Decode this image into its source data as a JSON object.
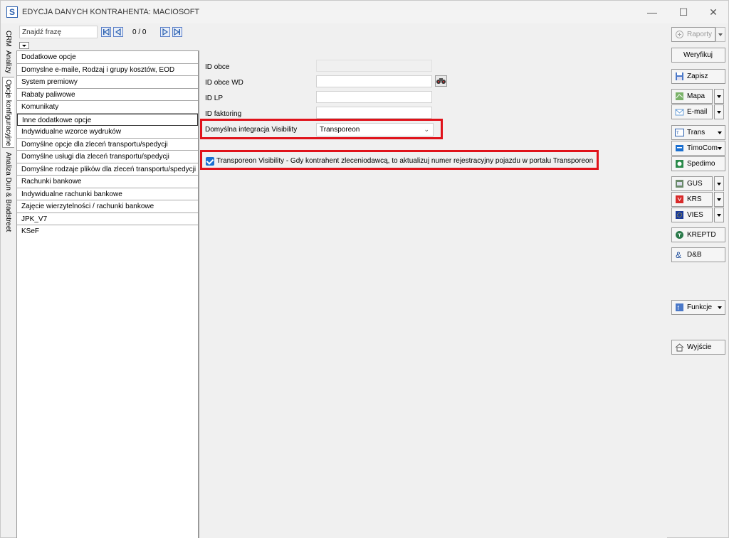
{
  "window": {
    "title": "EDYCJA DANYCH KONTRAHENTA: MACIOSOFT",
    "icon_letter": "S",
    "minimize": "—",
    "maximize": "☐",
    "close": "✕"
  },
  "vtabs": [
    "CRM",
    "Analizy",
    "Opcje konfiguracyjne",
    "Analiza Dun & Bradstreet"
  ],
  "search": {
    "placeholder": "Znajdź frazę",
    "value": "",
    "counter": "0 / 0"
  },
  "options": [
    "Dodatkowe opcje",
    "Domyslne e-maile, Rodzaj i grupy kosztów, EOD",
    "System premiowy",
    "Rabaty paliwowe",
    "Komunikaty",
    "Inne dodatkowe opcje",
    "Indywidualne wzorce wydruków",
    "Domyślne opcje dla zleceń transportu/spedycji",
    "Domyślne usługi dla zleceń transportu/spedycji",
    "Domyślne rodzaje plików dla zleceń transportu/spedycji",
    "Rachunki bankowe",
    "Indywidualne rachunki bankowe",
    "Zajęcie wierzytelności / rachunki bankowe",
    "JPK_V7",
    "KSeF"
  ],
  "selected_option_index": 5,
  "form": {
    "id_obce_label": "ID obce",
    "id_obce_wd_label": "ID obce WD",
    "id_lp_label": "ID LP",
    "id_faktoring_label": "ID faktoring",
    "visibility_label": "Domyślna integracja Visibility",
    "visibility_value": "Transporeon",
    "checkbox_label": "Transporeon Visibility - Gdy kontrahent zleceniodawcą, to aktualizuj numer rejestracyjny pojazdu w portalu Transporeon",
    "checkbox_checked": true
  },
  "right_buttons": {
    "raporty": "Raporty",
    "weryfikuj": "Weryfikuj",
    "zapisz": "Zapisz",
    "mapa": "Mapa",
    "email": "E-mail",
    "trans": "Trans",
    "timocom": "TimoCom",
    "spedimo": "Spedimo",
    "gus": "GUS",
    "krs": "KRS",
    "vies": "VIES",
    "kreptd": "KREPTD",
    "dnb": "D&B",
    "funkcje": "Funkcje",
    "wyjscie": "Wyjście"
  },
  "colors": {
    "highlight": "#e0121a",
    "accent": "#1a6fd0"
  }
}
